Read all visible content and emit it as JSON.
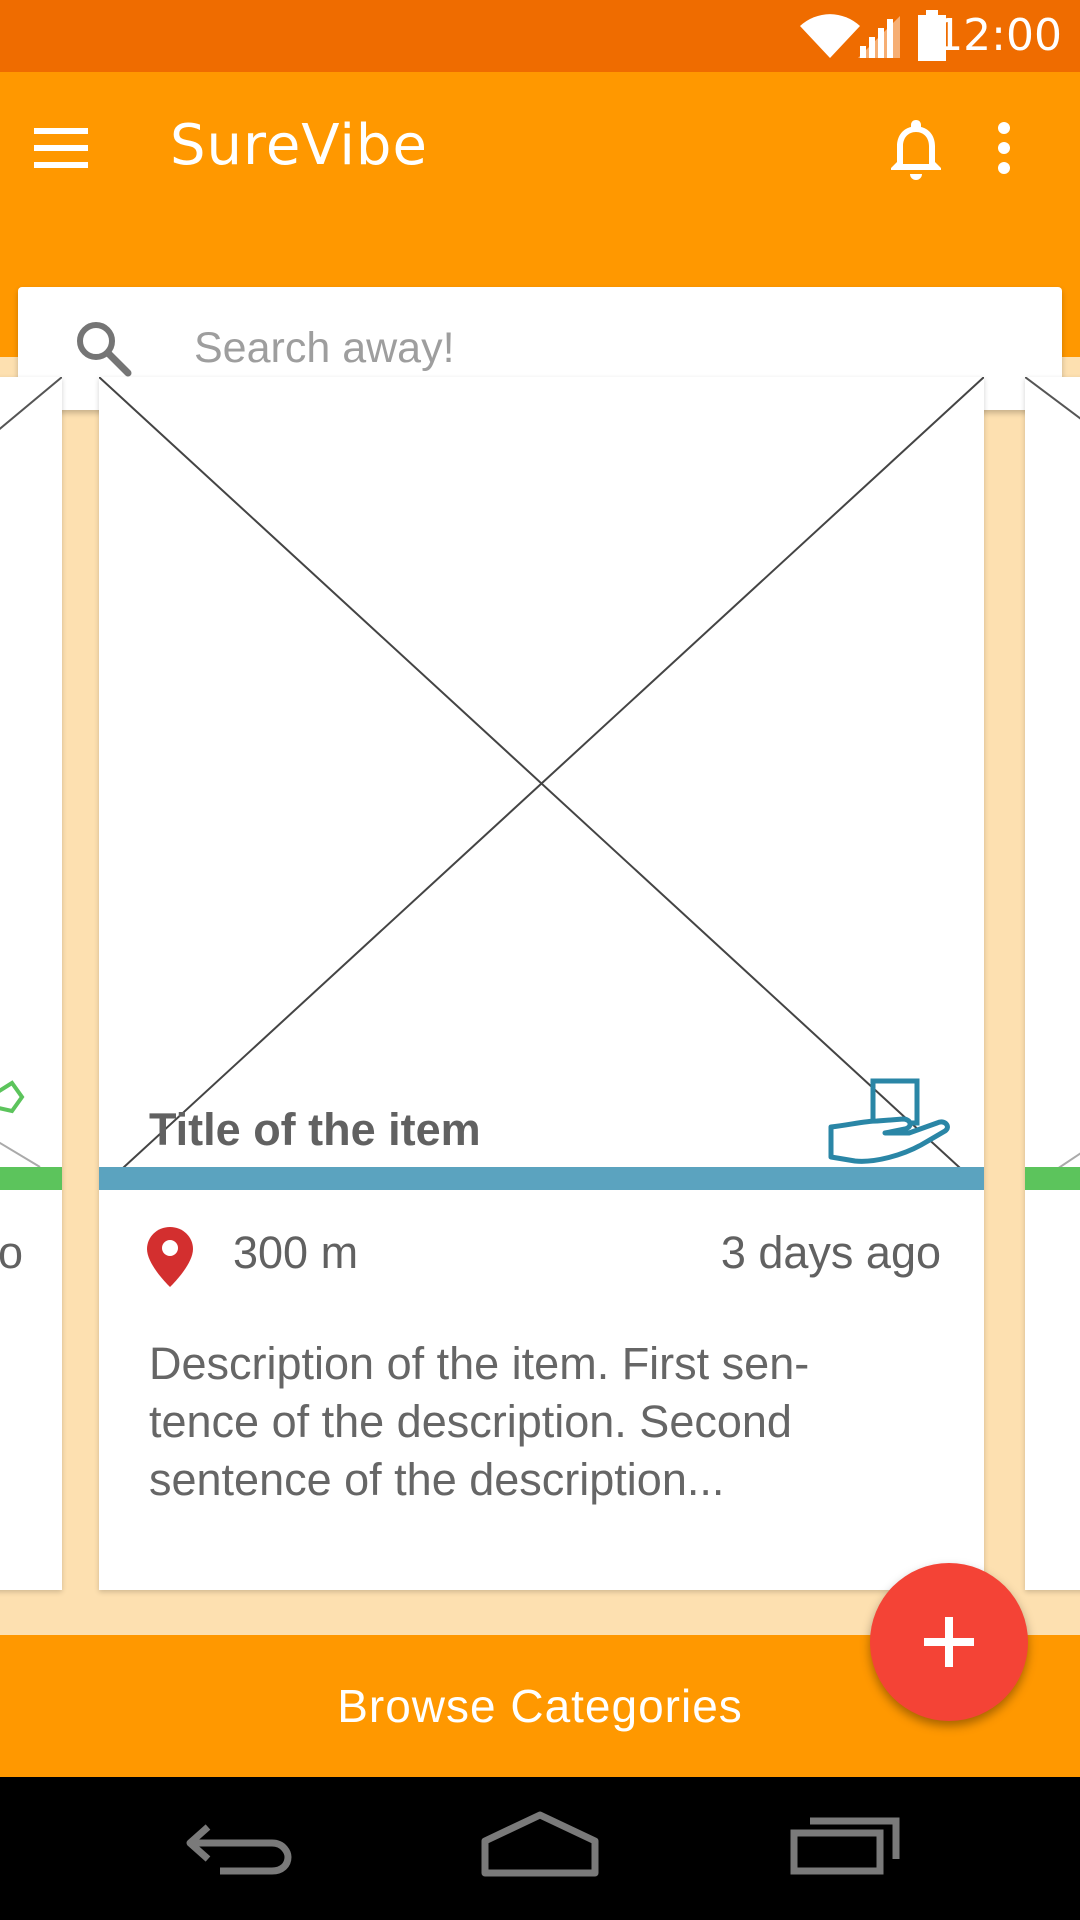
{
  "status_bar": {
    "time": "12:00",
    "icons": [
      "wifi-icon",
      "cell-signal-icon",
      "battery-icon"
    ]
  },
  "app_bar": {
    "title": "SureVibe",
    "icons": [
      "menu-icon",
      "bell-icon",
      "more-vert-icon"
    ]
  },
  "search": {
    "placeholder": "Search away!",
    "value": ""
  },
  "cards": {
    "main": {
      "title": "Title of the item",
      "distance": "300 m",
      "time_ago": "3 days ago",
      "description": "Description of the item. First sen-tence of the description. Second sentence of the description...",
      "category_color": "#5ba3bf",
      "category_icon": "giving-hand-icon"
    },
    "left_peek": {
      "category_color": "#5cc45c",
      "text_fragment": "o"
    },
    "right_peek": {
      "category_color": "#5cc45c"
    }
  },
  "fab": {
    "icon": "plus-icon",
    "color": "#f44336"
  },
  "bottom_bar": {
    "label": "Browse Categories"
  },
  "nav_bar": {
    "icons": [
      "back-icon",
      "home-icon",
      "recents-icon"
    ]
  },
  "colors": {
    "primary": "#ff9800",
    "primary_dark": "#ef6c00",
    "background": "#fde0b0",
    "accent": "#f44336"
  }
}
